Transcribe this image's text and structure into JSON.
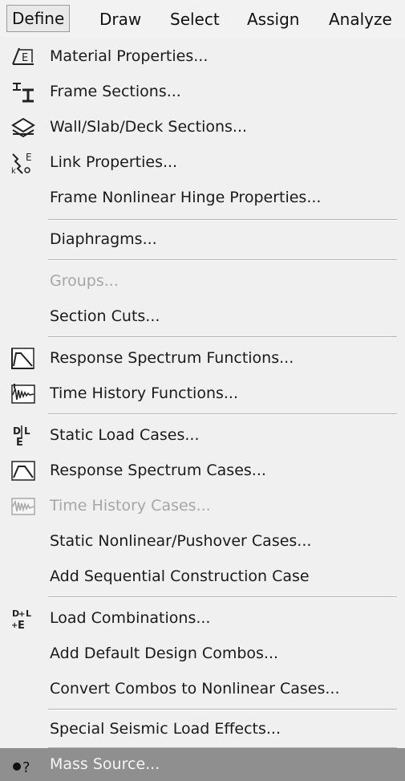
{
  "menubar": {
    "items": [
      "Define",
      "Draw",
      "Select",
      "Assign",
      "Analyze"
    ]
  },
  "menu": {
    "items": [
      {
        "label": "Material Properties...",
        "icon": "material-properties-icon",
        "enabled": true
      },
      {
        "label": "Frame Sections...",
        "icon": "frame-sections-icon",
        "enabled": true
      },
      {
        "label": "Wall/Slab/Deck Sections...",
        "icon": "wall-slab-deck-icon",
        "enabled": true
      },
      {
        "label": "Link Properties...",
        "icon": "link-properties-icon",
        "enabled": true
      },
      {
        "label": "Frame Nonlinear Hinge Properties...",
        "icon": null,
        "enabled": true
      },
      {
        "label": "Diaphragms...",
        "icon": null,
        "enabled": true
      },
      {
        "label": "Groups...",
        "icon": null,
        "enabled": false
      },
      {
        "label": "Section Cuts...",
        "icon": null,
        "enabled": true
      },
      {
        "label": "Response Spectrum Functions...",
        "icon": "response-spectrum-functions-icon",
        "enabled": true
      },
      {
        "label": "Time History Functions...",
        "icon": "time-history-functions-icon",
        "enabled": true
      },
      {
        "label": "Static Load Cases...",
        "icon": "static-load-cases-icon",
        "enabled": true
      },
      {
        "label": "Response Spectrum Cases...",
        "icon": "response-spectrum-cases-icon",
        "enabled": true
      },
      {
        "label": "Time History Cases...",
        "icon": "time-history-cases-icon",
        "enabled": false
      },
      {
        "label": "Static Nonlinear/Pushover Cases...",
        "icon": null,
        "enabled": true
      },
      {
        "label": "Add Sequential Construction Case",
        "icon": null,
        "enabled": true
      },
      {
        "label": "Load Combinations...",
        "icon": "load-combinations-icon",
        "enabled": true
      },
      {
        "label": "Add Default Design Combos...",
        "icon": null,
        "enabled": true
      },
      {
        "label": "Convert Combos to Nonlinear Cases...",
        "icon": null,
        "enabled": true
      },
      {
        "label": "Special Seismic Load Effects...",
        "icon": null,
        "enabled": true
      },
      {
        "label": "Mass Source...",
        "icon": "mass-source-icon",
        "enabled": true,
        "highlighted": true
      }
    ]
  }
}
